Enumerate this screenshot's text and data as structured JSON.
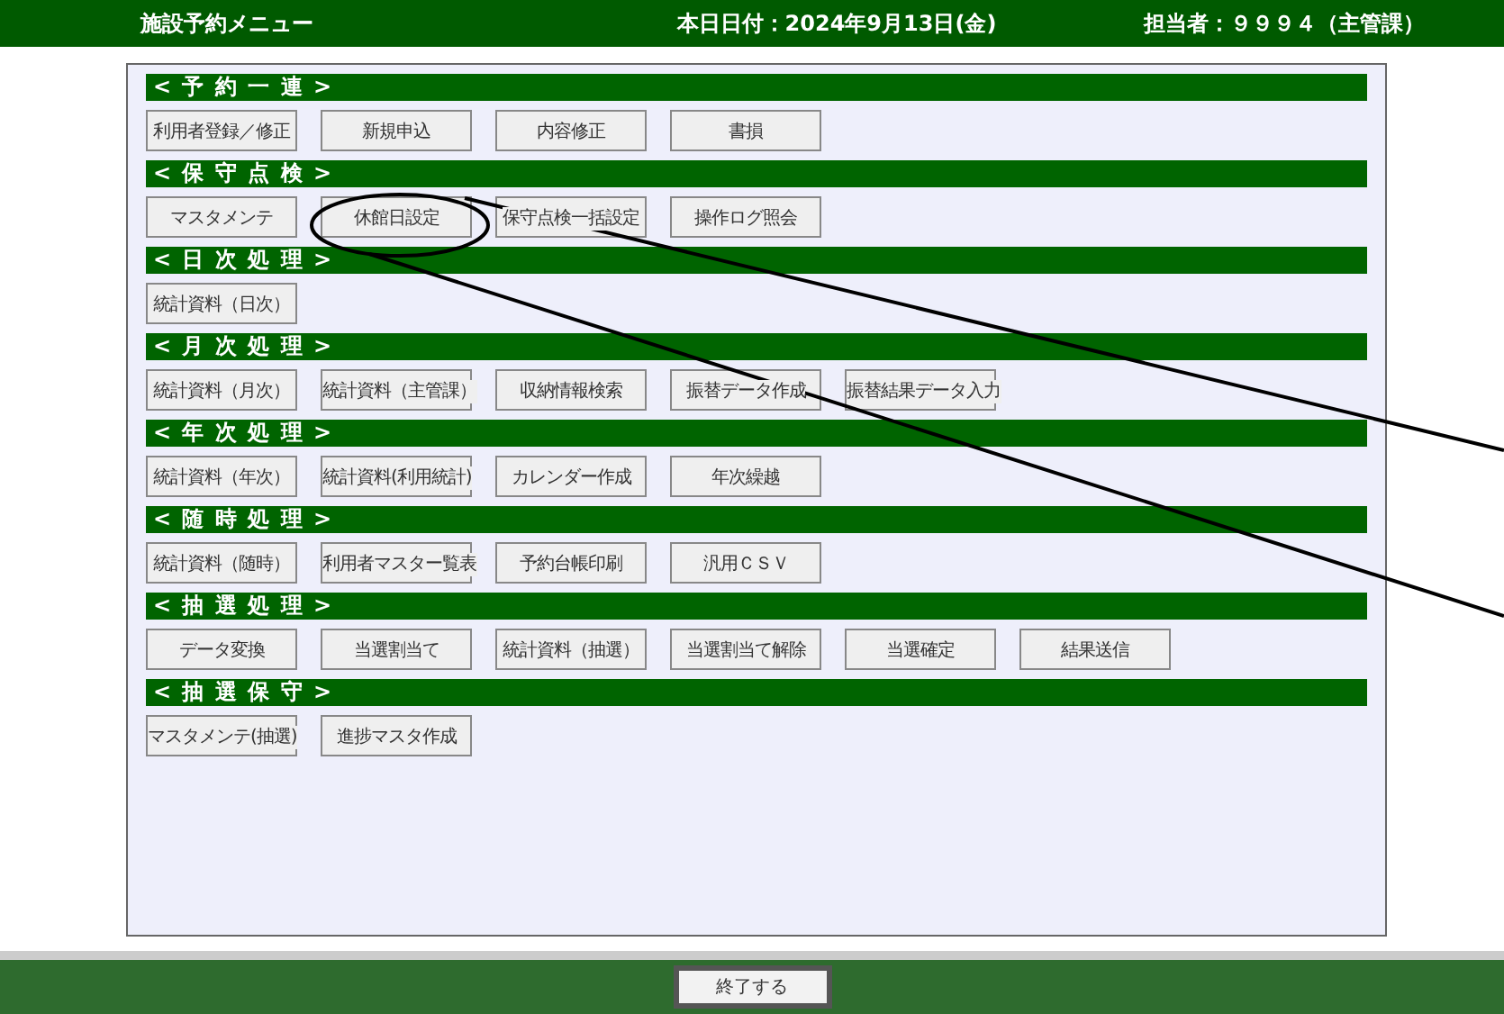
{
  "header": {
    "title": "施設予約メニュー",
    "date": "本日日付：2024年9月13日(金)",
    "user": "担当者：９９９４（主管課）"
  },
  "sections": [
    {
      "title": "< 予 約 一 連 >",
      "buttons": [
        "利用者登録／修正",
        "新規申込",
        "内容修正",
        "書損"
      ]
    },
    {
      "title": "< 保 守 点 検 >",
      "buttons": [
        "マスタメンテ",
        "休館日設定",
        "保守点検一括設定",
        "操作ログ照会"
      ]
    },
    {
      "title": "< 日 次 処 理 >",
      "buttons": [
        "統計資料（日次）"
      ]
    },
    {
      "title": "< 月 次 処 理 >",
      "buttons": [
        "統計資料（月次）",
        "統計資料（主管課）",
        "収納情報検索",
        "振替データ作成",
        "振替結果データ入力"
      ]
    },
    {
      "title": "< 年 次 処 理 >",
      "buttons": [
        "統計資料（年次）",
        "統計資料(利用統計)",
        "カレンダー作成",
        "年次繰越"
      ]
    },
    {
      "title": "< 随 時 処 理 >",
      "buttons": [
        "統計資料（随時）",
        "利用者マスター覧表",
        "予約台帳印刷",
        "汎用ＣＳＶ"
      ]
    },
    {
      "title": "< 抽 選 処 理 >",
      "buttons": [
        "データ変換",
        "当選割当て",
        "統計資料（抽選）",
        "当選割当て解除",
        "当選確定",
        "結果送信"
      ]
    },
    {
      "title": "< 抽 選 保 守 >",
      "buttons": [
        "マスタメンテ(抽選)",
        "進捗マスタ作成"
      ]
    }
  ],
  "footer": {
    "button": "終了する"
  }
}
